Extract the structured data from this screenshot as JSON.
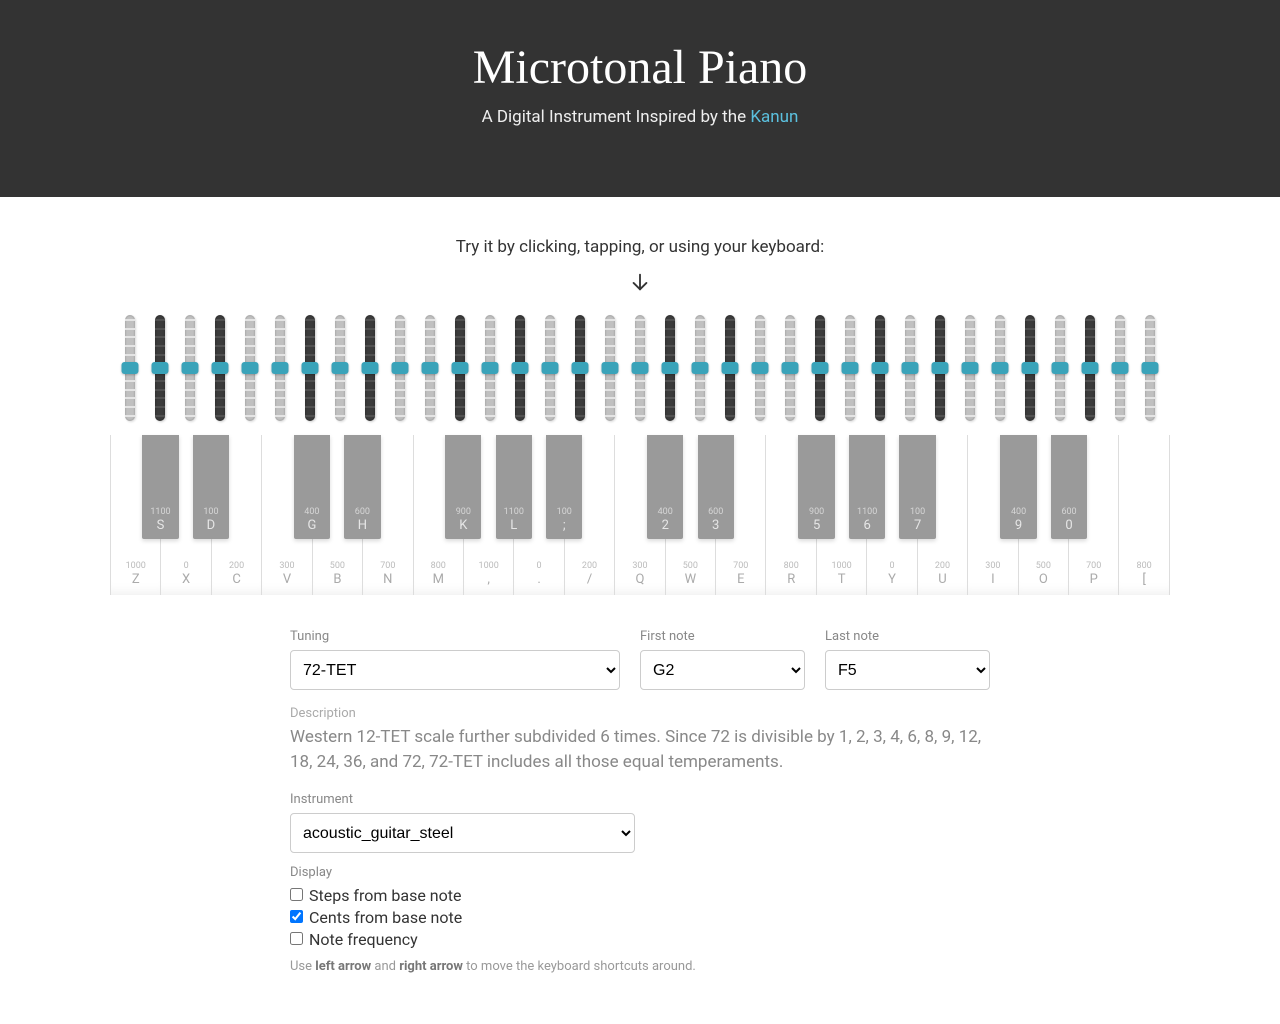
{
  "hero": {
    "title": "Microtonal Piano",
    "subtitle_prefix": "A Digital Instrument Inspired by the ",
    "link_text": "Kanun"
  },
  "tryit": "Try it by clicking, tapping, or using your keyboard:",
  "white_keys": [
    {
      "cents": "1000",
      "kbd": "Z"
    },
    {
      "cents": "0",
      "kbd": "X"
    },
    {
      "cents": "200",
      "kbd": "C"
    },
    {
      "cents": "300",
      "kbd": "V"
    },
    {
      "cents": "500",
      "kbd": "B"
    },
    {
      "cents": "700",
      "kbd": "N"
    },
    {
      "cents": "800",
      "kbd": "M"
    },
    {
      "cents": "1000",
      "kbd": ","
    },
    {
      "cents": "0",
      "kbd": "."
    },
    {
      "cents": "200",
      "kbd": "/"
    },
    {
      "cents": "300",
      "kbd": "Q"
    },
    {
      "cents": "500",
      "kbd": "W"
    },
    {
      "cents": "700",
      "kbd": "E"
    },
    {
      "cents": "800",
      "kbd": "R"
    },
    {
      "cents": "1000",
      "kbd": "T"
    },
    {
      "cents": "0",
      "kbd": "Y"
    },
    {
      "cents": "200",
      "kbd": "U"
    },
    {
      "cents": "300",
      "kbd": "I"
    },
    {
      "cents": "500",
      "kbd": "O"
    },
    {
      "cents": "700",
      "kbd": "P"
    },
    {
      "cents": "800",
      "kbd": "["
    }
  ],
  "black_keys": [
    {
      "after": 0,
      "cents": "1100",
      "kbd": "S"
    },
    {
      "after": 1,
      "cents": "100",
      "kbd": "D"
    },
    {
      "after": 3,
      "cents": "400",
      "kbd": "G"
    },
    {
      "after": 4,
      "cents": "600",
      "kbd": "H"
    },
    {
      "after": 6,
      "cents": "900",
      "kbd": "K"
    },
    {
      "after": 7,
      "cents": "1100",
      "kbd": "L"
    },
    {
      "after": 8,
      "cents": "100",
      "kbd": ";"
    },
    {
      "after": 10,
      "cents": "400",
      "kbd": "2"
    },
    {
      "after": 11,
      "cents": "600",
      "kbd": "3"
    },
    {
      "after": 13,
      "cents": "900",
      "kbd": "5"
    },
    {
      "after": 14,
      "cents": "1100",
      "kbd": "6"
    },
    {
      "after": 15,
      "cents": "100",
      "kbd": "7"
    },
    {
      "after": 17,
      "cents": "400",
      "kbd": "9"
    },
    {
      "after": 18,
      "cents": "600",
      "kbd": "0"
    }
  ],
  "form": {
    "tuning_label": "Tuning",
    "tuning_value": "72-TET",
    "first_note_label": "First note",
    "first_note_value": "G2",
    "last_note_label": "Last note",
    "last_note_value": "F5",
    "description_label": "Description",
    "description": "Western 12-TET scale further subdivided 6 times. Since 72 is divisible by 1, 2, 3, 4, 6, 8, 9, 12, 18, 24, 36, and 72, 72-TET includes all those equal temperaments.",
    "instrument_label": "Instrument",
    "instrument_value": "acoustic_guitar_steel",
    "display_label": "Display",
    "display_options": {
      "steps": "Steps from base note",
      "cents": "Cents from base note",
      "freq": "Note frequency"
    },
    "hint_prefix": "Use ",
    "hint_left": "left arrow",
    "hint_and": " and ",
    "hint_right": "right arrow",
    "hint_suffix": " to move the keyboard shortcuts around."
  },
  "slider_count": 35
}
